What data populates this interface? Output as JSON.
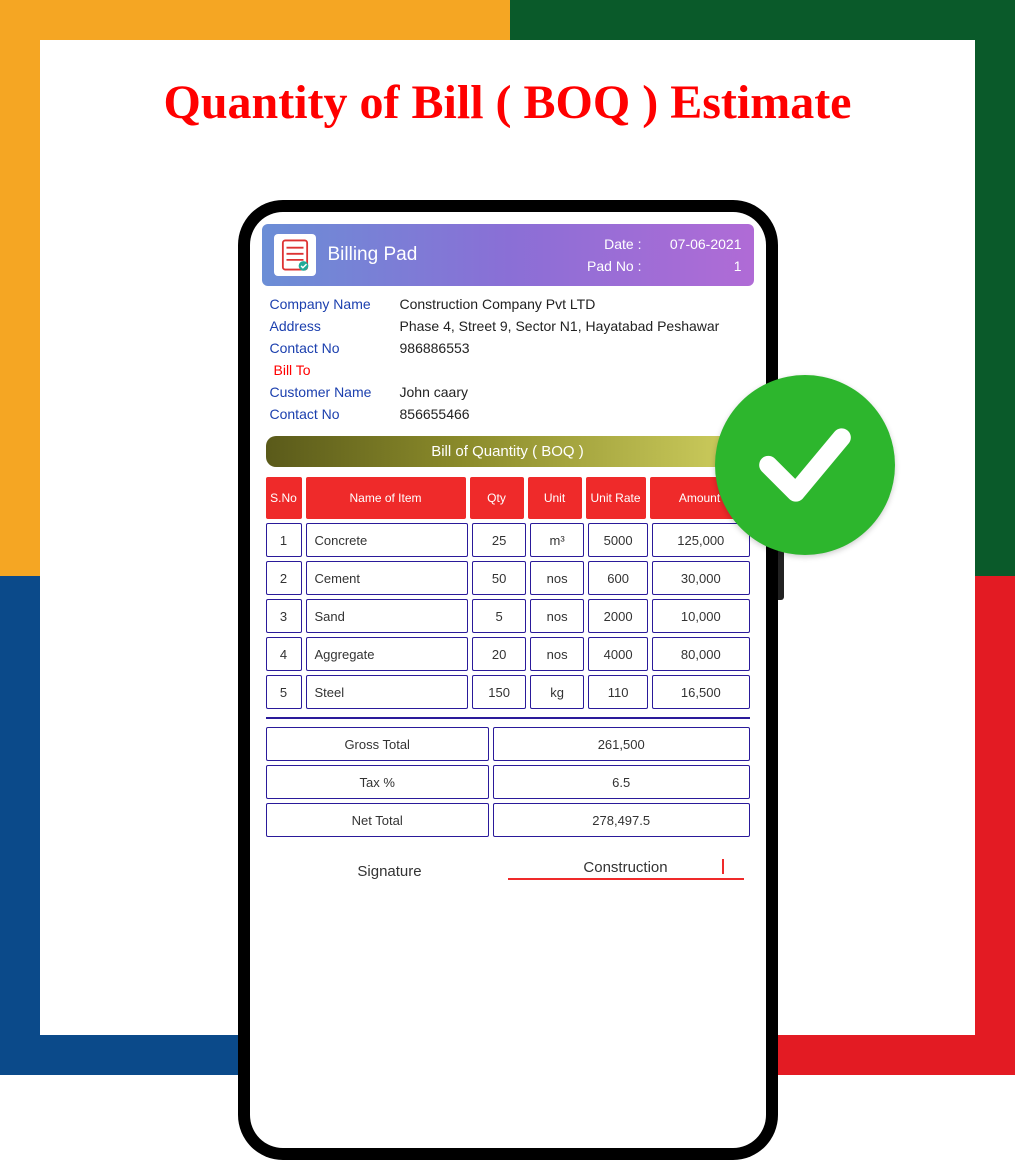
{
  "page_title": "Quantity of Bill ( BOQ ) Estimate",
  "header": {
    "title": "Billing Pad",
    "date_label": "Date :",
    "date_value": "07-06-2021",
    "pad_label": "Pad No :",
    "pad_value": "1"
  },
  "company": {
    "name_label": "Company Name",
    "name_value": "Construction Company Pvt LTD",
    "address_label": "Address",
    "address_value": "Phase 4, Street 9, Sector N1, Hayatabad Peshawar",
    "contact_label": "Contact No",
    "contact_value": "986886553"
  },
  "bill_to_label": "Bill To",
  "customer": {
    "name_label": "Customer Name",
    "name_value": "John caary",
    "contact_label": "Contact No",
    "contact_value": "856655466"
  },
  "section_title": "Bill of Quantity ( BOQ )",
  "columns": {
    "sno": "S.No",
    "name": "Name of Item",
    "qty": "Qty",
    "unit": "Unit",
    "rate": "Unit Rate",
    "amount": "Amount"
  },
  "items": [
    {
      "sno": "1",
      "name": "Concrete",
      "qty": "25",
      "unit": "m³",
      "rate": "5000",
      "amount": "125,000"
    },
    {
      "sno": "2",
      "name": "Cement",
      "qty": "50",
      "unit": "nos",
      "rate": "600",
      "amount": "30,000"
    },
    {
      "sno": "3",
      "name": "Sand",
      "qty": "5",
      "unit": "nos",
      "rate": "2000",
      "amount": "10,000"
    },
    {
      "sno": "4",
      "name": "Aggregate",
      "qty": "20",
      "unit": "nos",
      "rate": "4000",
      "amount": "80,000"
    },
    {
      "sno": "5",
      "name": "Steel",
      "qty": "150",
      "unit": "kg",
      "rate": "110",
      "amount": "16,500"
    }
  ],
  "summary": {
    "gross_label": "Gross Total",
    "gross_value": "261,500",
    "tax_label": "Tax %",
    "tax_value": "6.5",
    "net_label": "Net Total",
    "net_value": "278,497.5"
  },
  "signature": {
    "label": "Signature",
    "value": "Construction"
  }
}
